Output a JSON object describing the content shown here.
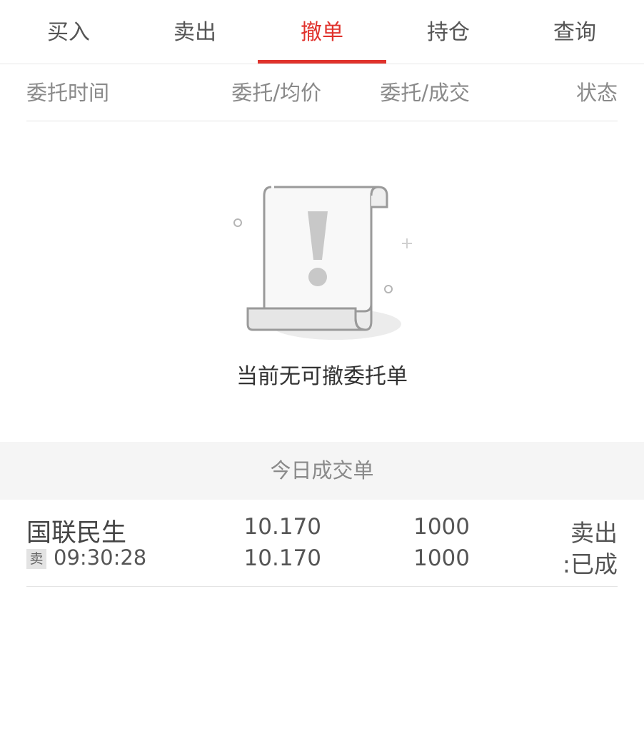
{
  "tabs": [
    {
      "label": "买入"
    },
    {
      "label": "卖出"
    },
    {
      "label": "撤单"
    },
    {
      "label": "持仓"
    },
    {
      "label": "查询"
    }
  ],
  "active_tab": "撤单",
  "columns": {
    "time": "委托时间",
    "price": "委托/均价",
    "qty": "委托/成交",
    "status": "状态"
  },
  "empty_state": {
    "message": "当前无可撤委托单",
    "icon": "document-warning-icon"
  },
  "section_title": "今日成交单",
  "trades": [
    {
      "name": "国联民生",
      "side_badge": "卖",
      "time": "09:30:28",
      "order_price": "10.170",
      "avg_price": "10.170",
      "order_qty": "1000",
      "filled_qty": "1000",
      "status_line1": "卖出",
      "status_line2": ":已成"
    }
  ],
  "colors": {
    "accent": "#e0322c",
    "section_bg": "#f5f5f5"
  }
}
